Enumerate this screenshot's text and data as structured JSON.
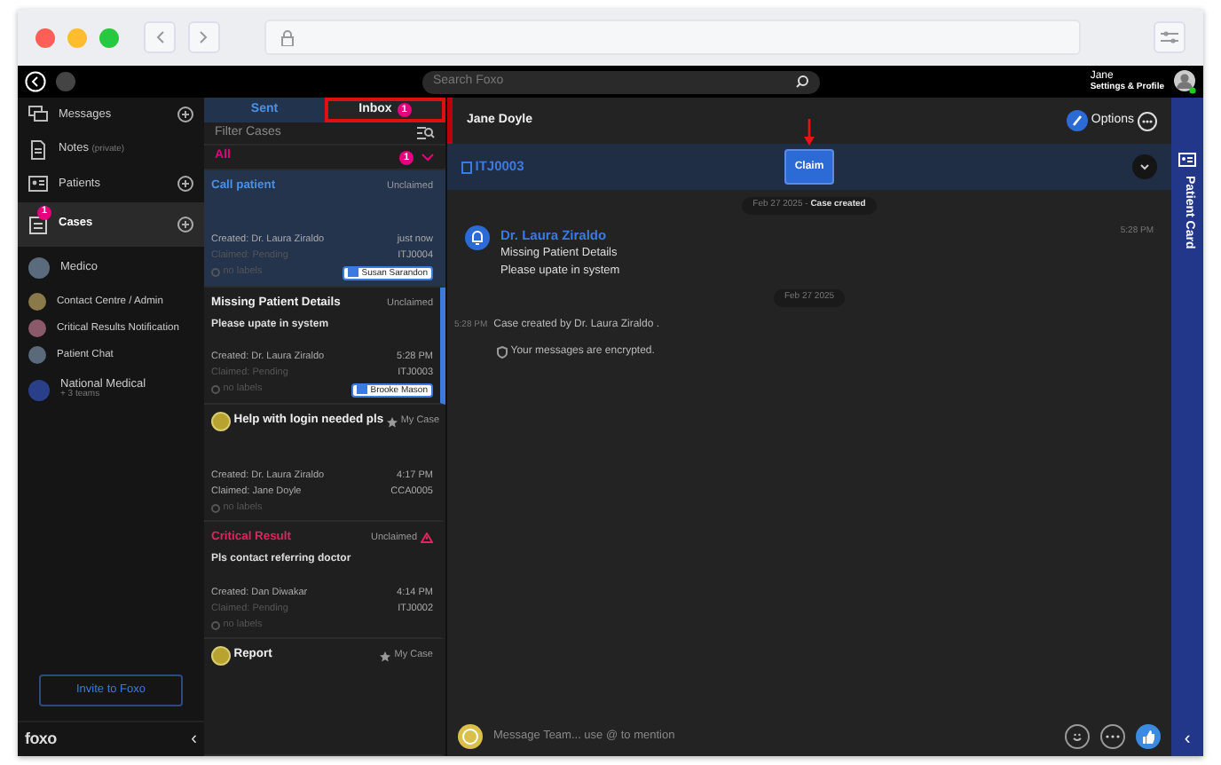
{
  "topbar": {
    "search": {
      "placeholder": "Search Foxo"
    },
    "user": {
      "name": "Jane",
      "link": "Settings & Profile",
      "online": true
    }
  },
  "sidebar": {
    "items": [
      {
        "kind": "section",
        "label": "Messages",
        "add": true,
        "selected": false
      },
      {
        "kind": "section",
        "label": "Notes",
        "note": "(private)",
        "add": false,
        "selected": false
      },
      {
        "kind": "section",
        "label": "Patients",
        "add": true,
        "selected": false
      },
      {
        "kind": "section",
        "label": "Cases",
        "badge": "1",
        "add": true,
        "selected": true
      },
      {
        "kind": "team",
        "label": "Medico",
        "selected": false,
        "color": "#5a6b7d"
      },
      {
        "kind": "subteam",
        "label": "Contact Centre / Admin",
        "selected": false,
        "color": "#8a7a4a"
      },
      {
        "kind": "subteam",
        "label": "Critical Results Notification",
        "selected": false,
        "color": "#8a5a6a"
      },
      {
        "kind": "subteam",
        "label": "Patient Chat",
        "selected": false,
        "color": "#5a6a7a"
      },
      {
        "kind": "team",
        "label": "National Medical",
        "sub": "+ 3 teams",
        "selected": false,
        "color": "#2a3f8a"
      }
    ],
    "invite": "Invite to Foxo",
    "logo": "foxo",
    "collapse": "‹"
  },
  "cases": {
    "tabs": [
      {
        "label": "Sent",
        "selected": false,
        "highlighted": false
      },
      {
        "label": "Inbox",
        "badge": "1",
        "selected": true,
        "highlighted": true
      }
    ],
    "filter": {
      "placeholder": "Filter Cases"
    },
    "group": {
      "label": "All",
      "badge": "1"
    },
    "items": [
      {
        "title": "Call patient",
        "status": "Unclaimed",
        "mine": false,
        "urgent": false,
        "unread": true,
        "selected": false,
        "avatar": false,
        "created": "Created: Dr. Laura Ziraldo",
        "time": "just now",
        "claimed": "Claimed:  Pending",
        "claimed_pending": true,
        "id": "ITJ0004",
        "labels": "no labels",
        "assignee": "Susan Sarandon"
      },
      {
        "title": "Missing Patient Details",
        "status": "Unclaimed",
        "mine": false,
        "urgent": false,
        "unread": false,
        "selected": true,
        "avatar": false,
        "subtitle": "Please upate in system",
        "created": "Created: Dr. Laura Ziraldo",
        "time": "5:28 PM",
        "claimed": "Claimed:  Pending",
        "claimed_pending": true,
        "id": "ITJ0003",
        "labels": "no labels",
        "assignee": "Brooke Mason"
      },
      {
        "title": "Help with login needed pls",
        "status": "My Case",
        "mine": true,
        "urgent": false,
        "unread": false,
        "selected": false,
        "avatar": true,
        "created": "Created: Dr. Laura Ziraldo",
        "time": "4:17 PM",
        "claimed": "Claimed:  Jane Doyle",
        "claimed_pending": false,
        "id": "CCA0005",
        "labels": "no labels"
      },
      {
        "title": "Critical Result",
        "status": "Unclaimed",
        "mine": false,
        "urgent": true,
        "unread": false,
        "selected": false,
        "avatar": false,
        "subtitle": "Pls contact referring doctor",
        "created": "Created: Dan Diwakar",
        "time": "4:14 PM",
        "claimed": "Claimed:  Pending",
        "claimed_pending": true,
        "id": "ITJ0002",
        "labels": "no labels"
      },
      {
        "title": "Report",
        "status": "My Case",
        "mine": true,
        "urgent": false,
        "unread": false,
        "selected": false,
        "avatar": true
      }
    ]
  },
  "chat": {
    "header": {
      "name": "Jane Doyle",
      "options": "Options"
    },
    "case_bar": {
      "id": "ITJ0003",
      "claim": "Claim",
      "claim_marked": true
    },
    "timeline": [
      {
        "kind": "date",
        "text": "Feb 27 2025 - **Case created**"
      },
      {
        "kind": "message",
        "sender": "Dr. Laura Ziraldo",
        "time": "5:28 PM",
        "lines": [
          "Missing Patient Details",
          "Please upate in system"
        ]
      },
      {
        "kind": "date",
        "text": "Feb 27 2025"
      },
      {
        "kind": "system",
        "time": "5:28 PM",
        "text": "Case created by Dr. Laura Ziraldo ."
      },
      {
        "kind": "notice",
        "text": "Your messages are encrypted."
      }
    ],
    "composer": {
      "placeholder": "Message Team... use @ to mention"
    },
    "patient_card": "Patient Card",
    "expand": "‹"
  }
}
